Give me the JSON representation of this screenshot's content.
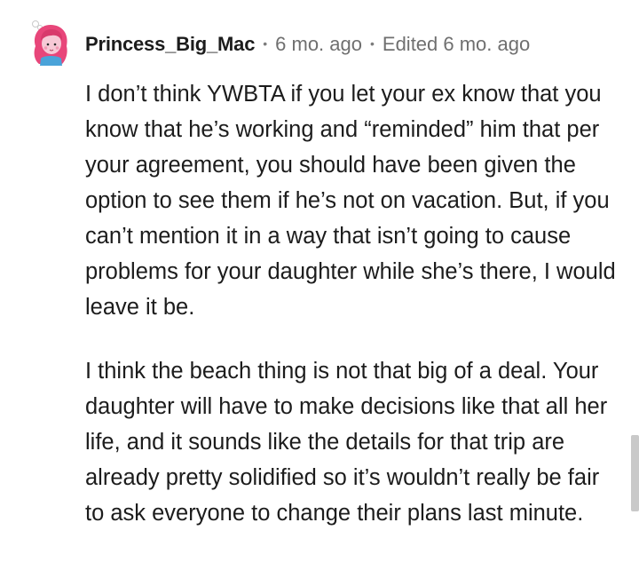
{
  "comment": {
    "username": "Princess_Big_Mac",
    "posted": "6 mo. ago",
    "edited": "Edited 6 mo. ago",
    "separator": "•",
    "avatar_icon": "avatar-pink-hair-icon",
    "paragraphs": [
      "I don’t think YWBTA if you let your ex know that you know that he’s working and “reminded” him that per your agreement, you should have been given the option to see them if he’s not on vacation. But, if you can’t mention it in a way that isn’t going to cause problems for your daughter while she’s there, I would leave it be.",
      "I think the beach thing is not that big of a deal. Your daughter will have to make decisions like that all her life, and it sounds like the details for that trip are already pretty solidified so it’s wouldn’t really be fair to ask everyone to change their plans last minute."
    ]
  },
  "colors": {
    "text": "#1c1c1c",
    "meta": "#6f6f6f",
    "avatar_hair": "#e8467a",
    "avatar_skin": "#f7c9d6",
    "avatar_shirt": "#4aa3d9",
    "scrollbar": "#c9c9c9"
  }
}
